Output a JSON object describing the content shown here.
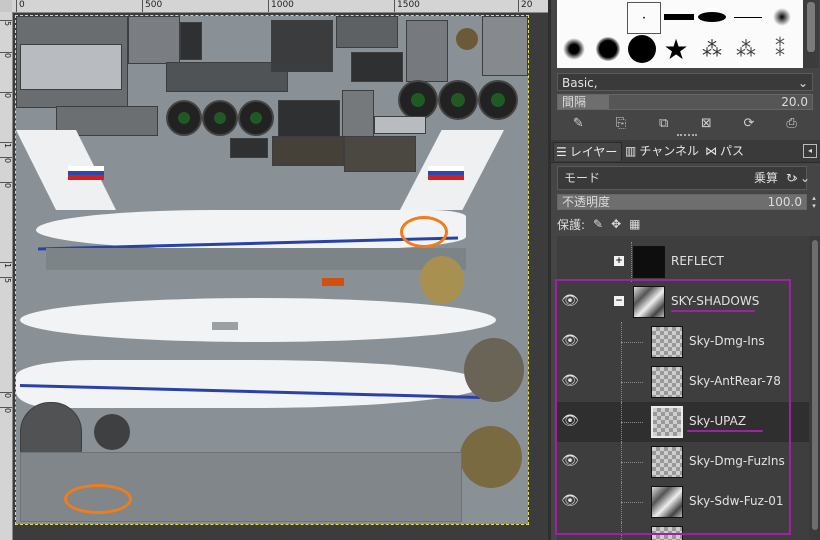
{
  "rulers": {
    "top_ticks": [
      "0",
      "500",
      "1000",
      "1500",
      "20"
    ],
    "left_ticks": [
      "5",
      "0",
      "0",
      "1",
      "0",
      "0",
      "1",
      "5",
      "0",
      "0"
    ]
  },
  "canvas": {
    "annotation_color": "#f07d1c",
    "selection_color": "#e8e04a"
  },
  "brushes": {
    "preset_name": "Basic,",
    "spacing_label": "間隔",
    "spacing_value": "20.0",
    "spacing_fraction": 0.2,
    "actions": [
      "edit-icon",
      "new-brush-icon",
      "duplicate-icon",
      "delete-icon",
      "refresh-icon",
      "open-as-image-icon"
    ]
  },
  "tabs": [
    {
      "label": "レイヤー",
      "icon": "layers-icon",
      "active": true
    },
    {
      "label": "チャンネル",
      "icon": "channels-icon",
      "active": false
    },
    {
      "label": "パス",
      "icon": "paths-icon",
      "active": false
    }
  ],
  "mode": {
    "label": "モード",
    "value": "乗算"
  },
  "opacity": {
    "label": "不透明度",
    "value": "100.0",
    "fraction": 1.0
  },
  "lock": {
    "label": "保護:"
  },
  "layers": [
    {
      "name": "REFLECT",
      "visible": false,
      "group": true,
      "expanded": false,
      "thumb": "black",
      "indent": 0,
      "selected": false
    },
    {
      "name": "SKY-SHADOWS",
      "visible": true,
      "group": true,
      "expanded": true,
      "thumb": "cloud",
      "indent": 0,
      "selected": false
    },
    {
      "name": "Sky-Dmg-Ins",
      "visible": true,
      "group": false,
      "thumb": "checker",
      "indent": 1,
      "selected": false
    },
    {
      "name": "Sky-AntRear-78",
      "visible": true,
      "group": false,
      "thumb": "checker",
      "indent": 1,
      "selected": false
    },
    {
      "name": "Sky-UPAZ",
      "visible": true,
      "group": false,
      "thumb": "checker",
      "indent": 1,
      "selected": true
    },
    {
      "name": "Sky-Dmg-FuzIns",
      "visible": true,
      "group": false,
      "thumb": "checker",
      "indent": 1,
      "selected": false
    },
    {
      "name": "Sky-Sdw-Fuz-01",
      "visible": true,
      "group": false,
      "thumb": "cloud",
      "indent": 1,
      "selected": false
    }
  ],
  "highlight_color": "#a020a8"
}
